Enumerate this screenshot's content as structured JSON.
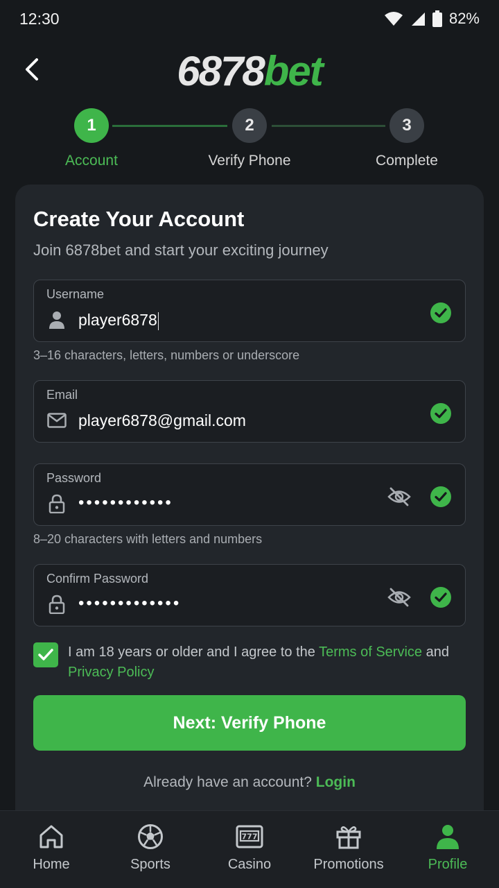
{
  "status_bar": {
    "time": "12:30",
    "battery": "82%"
  },
  "header": {
    "logo_number": "6878",
    "logo_suffix": "bet"
  },
  "stepper": {
    "steps": [
      {
        "number": "1",
        "label": "Account"
      },
      {
        "number": "2",
        "label": "Verify Phone"
      },
      {
        "number": "3",
        "label": "Complete"
      }
    ],
    "active_step": 1
  },
  "form": {
    "title": "Create Your Account",
    "subtitle": "Join 6878bet and start your exciting journey",
    "username": {
      "label": "Username",
      "value": "player6878",
      "hint": "3–16 characters, letters, numbers or underscore"
    },
    "email": {
      "label": "Email",
      "value": "player6878@gmail.com"
    },
    "password": {
      "label": "Password",
      "value": "••••••••••••",
      "hint": "8–20 characters with letters and numbers"
    },
    "confirm_password": {
      "label": "Confirm Password",
      "value": "•••••••••••••"
    },
    "agree": {
      "checked": true,
      "text_before": "I am 18 years or older and I agree to the ",
      "terms_link": "Terms of Service",
      "text_middle": " and ",
      "privacy_link": "Privacy Policy"
    },
    "submit_label": "Next: Verify Phone",
    "login_prompt": "Already have an account? ",
    "login_link": "Login"
  },
  "bottom_nav": {
    "items": [
      {
        "label": "Home",
        "icon": "home-icon"
      },
      {
        "label": "Sports",
        "icon": "soccer-ball-icon"
      },
      {
        "label": "Casino",
        "icon": "slot-machine-icon"
      },
      {
        "label": "Promotions",
        "icon": "gift-icon"
      },
      {
        "label": "Profile",
        "icon": "user-icon"
      }
    ],
    "active": "Profile"
  },
  "colors": {
    "accent": "#3fb54a",
    "background": "#16191c",
    "card": "#22262b"
  }
}
